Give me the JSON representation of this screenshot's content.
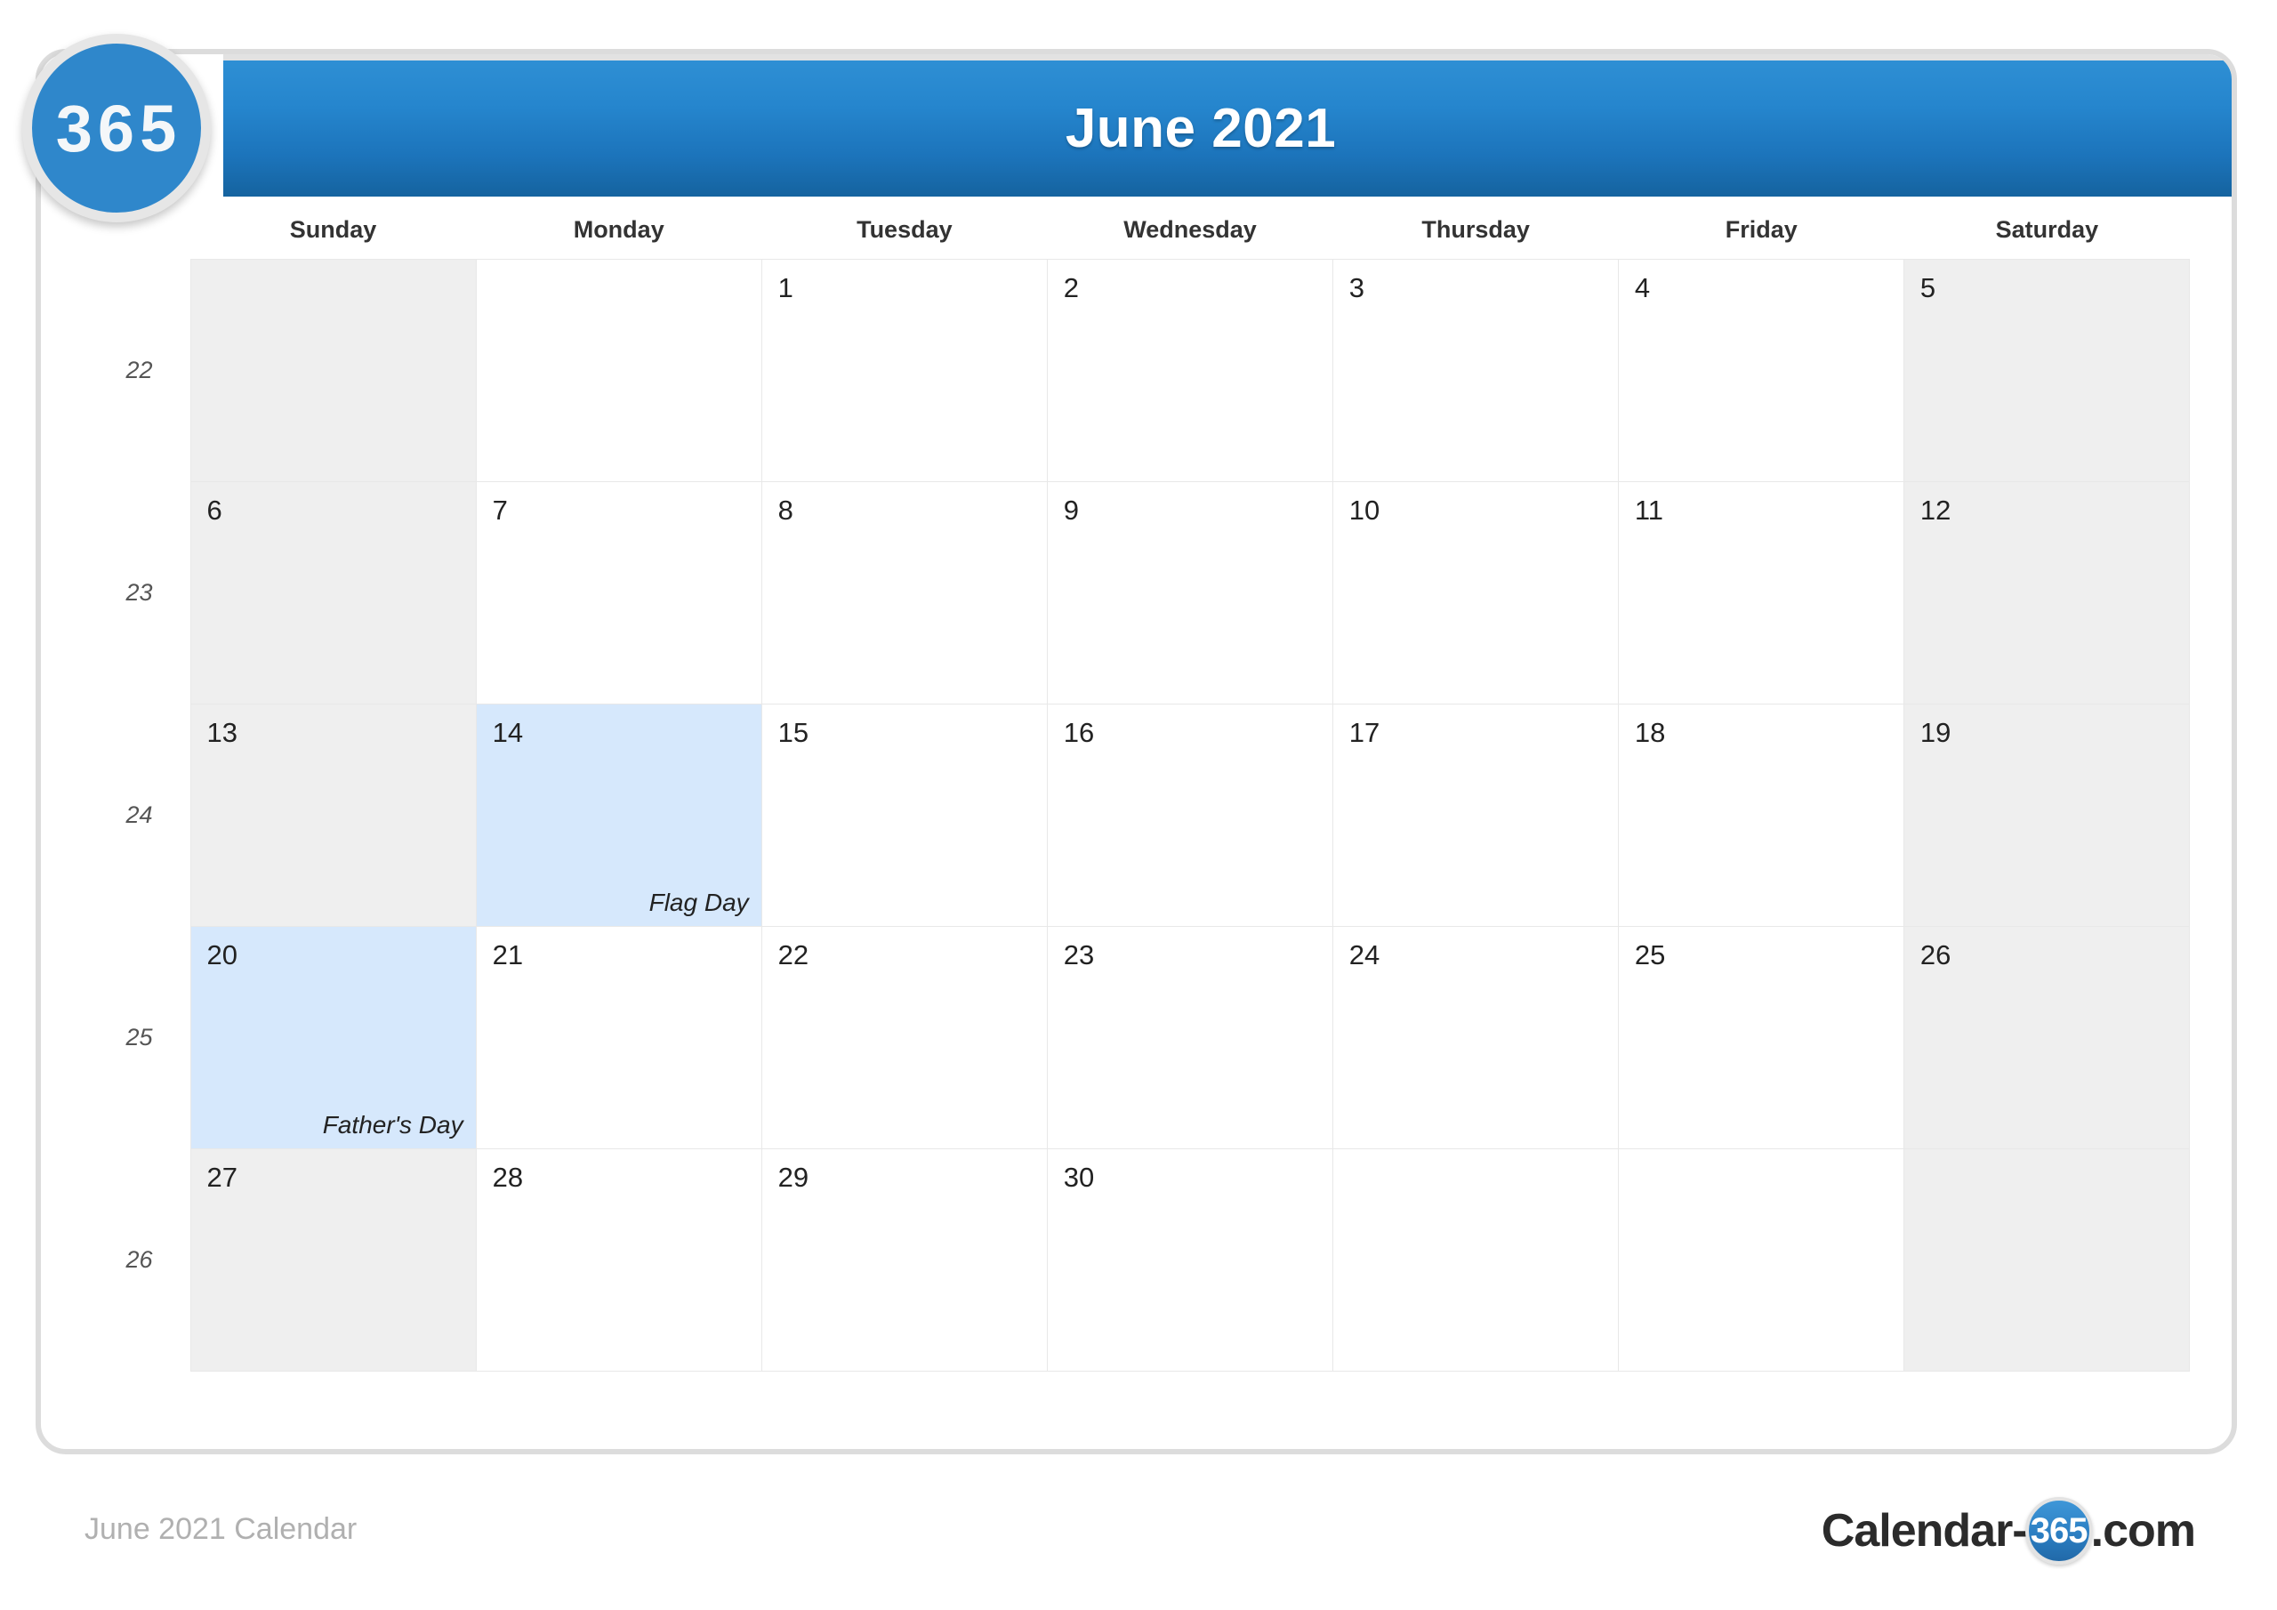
{
  "branding": {
    "badge_label": "365",
    "footer_logo_prefix": "Calendar-",
    "footer_logo_circle": "365",
    "footer_logo_suffix": ".com",
    "watermark_text": "365",
    "accent_blue": "#2585cd",
    "highlight_blue": "#d6e8fc",
    "weekend_gray": "#efefef"
  },
  "header": {
    "title": "June 2021"
  },
  "footer": {
    "caption": "June 2021 Calendar"
  },
  "calendar": {
    "weekdays": [
      "Sunday",
      "Monday",
      "Tuesday",
      "Wednesday",
      "Thursday",
      "Friday",
      "Saturday"
    ],
    "week_numbers": [
      "22",
      "23",
      "24",
      "25",
      "26"
    ],
    "weeks": [
      {
        "week_number": "22",
        "days": [
          {
            "date": "",
            "holiday": "",
            "weekend": true,
            "empty": true
          },
          {
            "date": "",
            "holiday": "",
            "weekend": false,
            "empty": true
          },
          {
            "date": "1",
            "holiday": "",
            "weekend": false,
            "empty": false
          },
          {
            "date": "2",
            "holiday": "",
            "weekend": false,
            "empty": false
          },
          {
            "date": "3",
            "holiday": "",
            "weekend": false,
            "empty": false
          },
          {
            "date": "4",
            "holiday": "",
            "weekend": false,
            "empty": false
          },
          {
            "date": "5",
            "holiday": "",
            "weekend": true,
            "empty": false
          }
        ]
      },
      {
        "week_number": "23",
        "days": [
          {
            "date": "6",
            "holiday": "",
            "weekend": true,
            "empty": false
          },
          {
            "date": "7",
            "holiday": "",
            "weekend": false,
            "empty": false
          },
          {
            "date": "8",
            "holiday": "",
            "weekend": false,
            "empty": false
          },
          {
            "date": "9",
            "holiday": "",
            "weekend": false,
            "empty": false
          },
          {
            "date": "10",
            "holiday": "",
            "weekend": false,
            "empty": false
          },
          {
            "date": "11",
            "holiday": "",
            "weekend": false,
            "empty": false
          },
          {
            "date": "12",
            "holiday": "",
            "weekend": true,
            "empty": false
          }
        ]
      },
      {
        "week_number": "24",
        "days": [
          {
            "date": "13",
            "holiday": "",
            "weekend": true,
            "empty": false
          },
          {
            "date": "14",
            "holiday": "Flag Day",
            "weekend": false,
            "empty": false
          },
          {
            "date": "15",
            "holiday": "",
            "weekend": false,
            "empty": false
          },
          {
            "date": "16",
            "holiday": "",
            "weekend": false,
            "empty": false
          },
          {
            "date": "17",
            "holiday": "",
            "weekend": false,
            "empty": false
          },
          {
            "date": "18",
            "holiday": "",
            "weekend": false,
            "empty": false
          },
          {
            "date": "19",
            "holiday": "",
            "weekend": true,
            "empty": false
          }
        ]
      },
      {
        "week_number": "25",
        "days": [
          {
            "date": "20",
            "holiday": "Father's Day",
            "weekend": true,
            "empty": false
          },
          {
            "date": "21",
            "holiday": "",
            "weekend": false,
            "empty": false
          },
          {
            "date": "22",
            "holiday": "",
            "weekend": false,
            "empty": false
          },
          {
            "date": "23",
            "holiday": "",
            "weekend": false,
            "empty": false
          },
          {
            "date": "24",
            "holiday": "",
            "weekend": false,
            "empty": false
          },
          {
            "date": "25",
            "holiday": "",
            "weekend": false,
            "empty": false
          },
          {
            "date": "26",
            "holiday": "",
            "weekend": true,
            "empty": false
          }
        ]
      },
      {
        "week_number": "26",
        "days": [
          {
            "date": "27",
            "holiday": "",
            "weekend": true,
            "empty": false
          },
          {
            "date": "28",
            "holiday": "",
            "weekend": false,
            "empty": false
          },
          {
            "date": "29",
            "holiday": "",
            "weekend": false,
            "empty": false
          },
          {
            "date": "30",
            "holiday": "",
            "weekend": false,
            "empty": false
          },
          {
            "date": "",
            "holiday": "",
            "weekend": false,
            "empty": true
          },
          {
            "date": "",
            "holiday": "",
            "weekend": false,
            "empty": true
          },
          {
            "date": "",
            "holiday": "",
            "weekend": true,
            "empty": true
          }
        ]
      }
    ]
  }
}
